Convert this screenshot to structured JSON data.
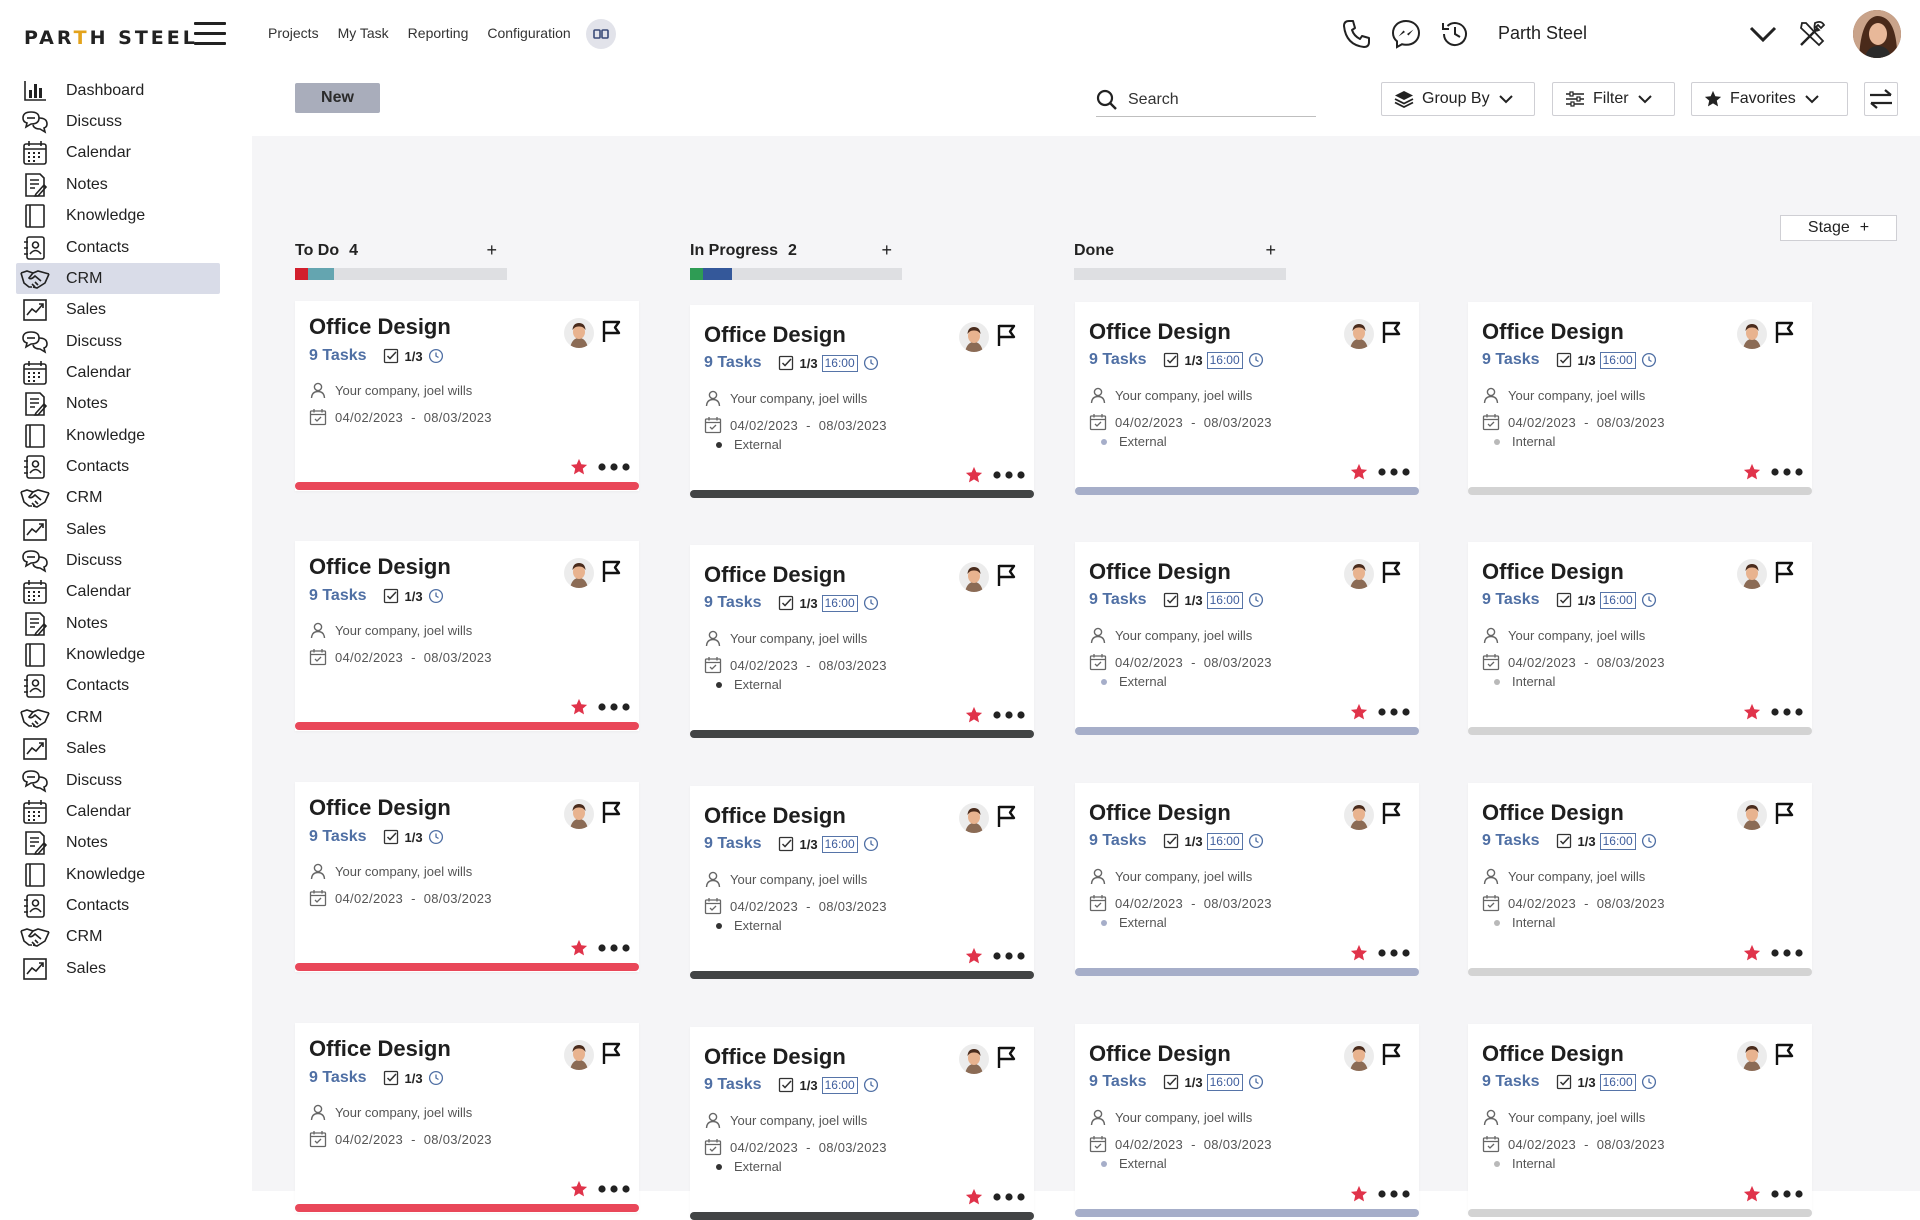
{
  "app": {
    "logo_pre": "PAR",
    "logo_gold": "T",
    "logo_post": "H STEEL",
    "company": "Parth Steel"
  },
  "topnav": [
    "Projects",
    "My Task",
    "Reporting",
    "Configuration"
  ],
  "sidebar": [
    {
      "label": "Dashboard",
      "icon": "bar-chart"
    },
    {
      "label": "Discuss",
      "icon": "chat"
    },
    {
      "label": "Calendar",
      "icon": "calendar"
    },
    {
      "label": "Notes",
      "icon": "notes"
    },
    {
      "label": "Knowledge",
      "icon": "book"
    },
    {
      "label": "Contacts",
      "icon": "contacts"
    },
    {
      "label": "CRM",
      "icon": "handshake",
      "active": true
    },
    {
      "label": "Sales",
      "icon": "trend"
    },
    {
      "label": "Discuss",
      "icon": "chat"
    },
    {
      "label": "Calendar",
      "icon": "calendar"
    },
    {
      "label": "Notes",
      "icon": "notes"
    },
    {
      "label": "Knowledge",
      "icon": "book"
    },
    {
      "label": "Contacts",
      "icon": "contacts"
    },
    {
      "label": "CRM",
      "icon": "handshake"
    },
    {
      "label": "Sales",
      "icon": "trend"
    },
    {
      "label": "Discuss",
      "icon": "chat"
    },
    {
      "label": "Calendar",
      "icon": "calendar"
    },
    {
      "label": "Notes",
      "icon": "notes"
    },
    {
      "label": "Knowledge",
      "icon": "book"
    },
    {
      "label": "Contacts",
      "icon": "contacts"
    },
    {
      "label": "CRM",
      "icon": "handshake"
    },
    {
      "label": "Sales",
      "icon": "trend"
    },
    {
      "label": "Discuss",
      "icon": "chat"
    },
    {
      "label": "Calendar",
      "icon": "calendar"
    },
    {
      "label": "Notes",
      "icon": "notes"
    },
    {
      "label": "Knowledge",
      "icon": "book"
    },
    {
      "label": "Contacts",
      "icon": "contacts"
    },
    {
      "label": "CRM",
      "icon": "handshake"
    },
    {
      "label": "Sales",
      "icon": "trend"
    }
  ],
  "toolbar": {
    "new_label": "New",
    "search_placeholder": "Search",
    "group_by_label": "Group By",
    "filter_label": "Filter",
    "favorites_label": "Favorites",
    "stage_label": "Stage",
    "stage_plus": "+"
  },
  "columns": [
    {
      "name": "To Do",
      "count": "4",
      "plus": "+",
      "progress": [
        {
          "color": "#d21f2d",
          "fraction": 0.06
        },
        {
          "color": "#64a5b0",
          "fraction": 0.125
        }
      ]
    },
    {
      "name": "In Progress",
      "count": "2",
      "plus": "+",
      "progress": [
        {
          "color": "#2e9c54",
          "fraction": 0.06
        },
        {
          "color": "#34589a",
          "fraction": 0.14
        }
      ]
    },
    {
      "name": "Done",
      "count": "",
      "plus": "+",
      "progress": []
    }
  ],
  "card_template": {
    "title": "Office Design",
    "tasks": "9 Tasks",
    "ratio": "1/3",
    "time": "16:00",
    "company": "Your company, joel wills",
    "date_start": "04/02/2023",
    "date_sep": "-",
    "date_end": "08/03/2023"
  },
  "card_columns": [
    {
      "variant": "todo",
      "bar_color": "#e94759",
      "label": "",
      "dot_color": "",
      "show_time": false
    },
    {
      "variant": "progress",
      "bar_color": "#424445",
      "label": "External",
      "dot_color": "#333333",
      "show_time": true
    },
    {
      "variant": "done",
      "bar_color": "#a6aec9",
      "label": "External",
      "dot_color": "#a6aec9",
      "show_time": true
    },
    {
      "variant": "done2",
      "bar_color": "#d3d3d3",
      "label": "Internal",
      "dot_color": "#b9b9b9",
      "show_time": true
    }
  ],
  "colors": {
    "star": "#e0334a",
    "tasks_blue": "#4f6fa4",
    "active_side": "#d9dce8"
  }
}
